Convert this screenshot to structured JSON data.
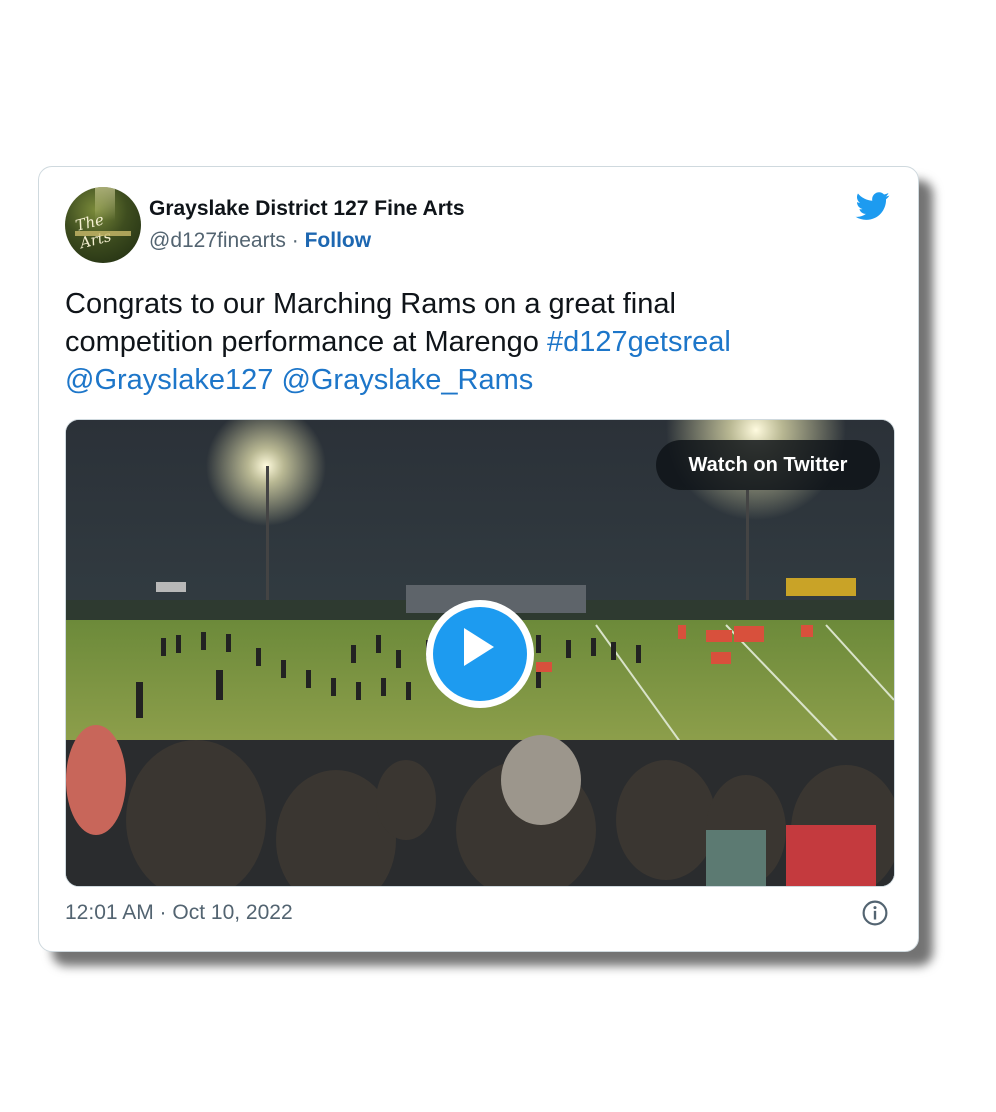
{
  "author": {
    "name": "Grayslake District 127 Fine Arts",
    "handle": "@d127finearts",
    "separator": "·",
    "follow_label": "Follow",
    "avatar_text": "The Arts",
    "avatar_icon": "profile-avatar"
  },
  "tweet": {
    "text_line1": "Congrats to our Marching Rams on a great final",
    "text_line2_plain": "competition performance at Marengo ",
    "hashtag": "#d127getsreal",
    "mention1": "@Grayslake127",
    "mention2": "@Grayslake_Rams"
  },
  "media": {
    "watch_label": "Watch on Twitter",
    "play_icon": "play-icon"
  },
  "footer": {
    "timestamp": "12:01 AM · Oct 10, 2022",
    "info_icon": "info-icon"
  },
  "colors": {
    "brand_blue": "#1d9bf0",
    "link_blue": "#1d76c9",
    "text_dark": "#0f1419",
    "text_muted": "#536471"
  }
}
